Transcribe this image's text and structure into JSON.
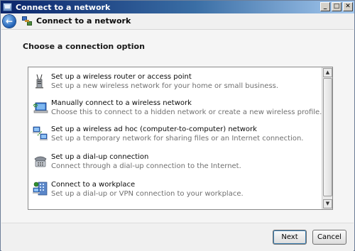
{
  "window": {
    "title": "Connect to a network",
    "controls": {
      "minimize": "_",
      "maximize": "□",
      "close": "✕"
    }
  },
  "header": {
    "back_icon": "back-arrow-icon",
    "title": "Connect to a network"
  },
  "content": {
    "instruction": "Choose a connection option",
    "options": [
      {
        "icon": "wireless-router-icon",
        "title": "Set up a wireless router or access point",
        "description": "Set up a new wireless network for your home or small business."
      },
      {
        "icon": "manual-wireless-icon",
        "title": "Manually connect to a wireless network",
        "description": "Choose this to connect to a hidden network or create a new wireless profile."
      },
      {
        "icon": "adhoc-network-icon",
        "title": "Set up a wireless ad hoc (computer-to-computer) network",
        "description": "Set up a temporary network for sharing files or an Internet connection."
      },
      {
        "icon": "dialup-phone-icon",
        "title": "Set up a dial-up connection",
        "description": "Connect through a dial-up connection to the Internet."
      },
      {
        "icon": "workplace-icon",
        "title": "Connect to a workplace",
        "description": "Set up a dial-up or VPN connection to your workplace."
      }
    ]
  },
  "footer": {
    "next_label": "Next",
    "cancel_label": "Cancel"
  }
}
